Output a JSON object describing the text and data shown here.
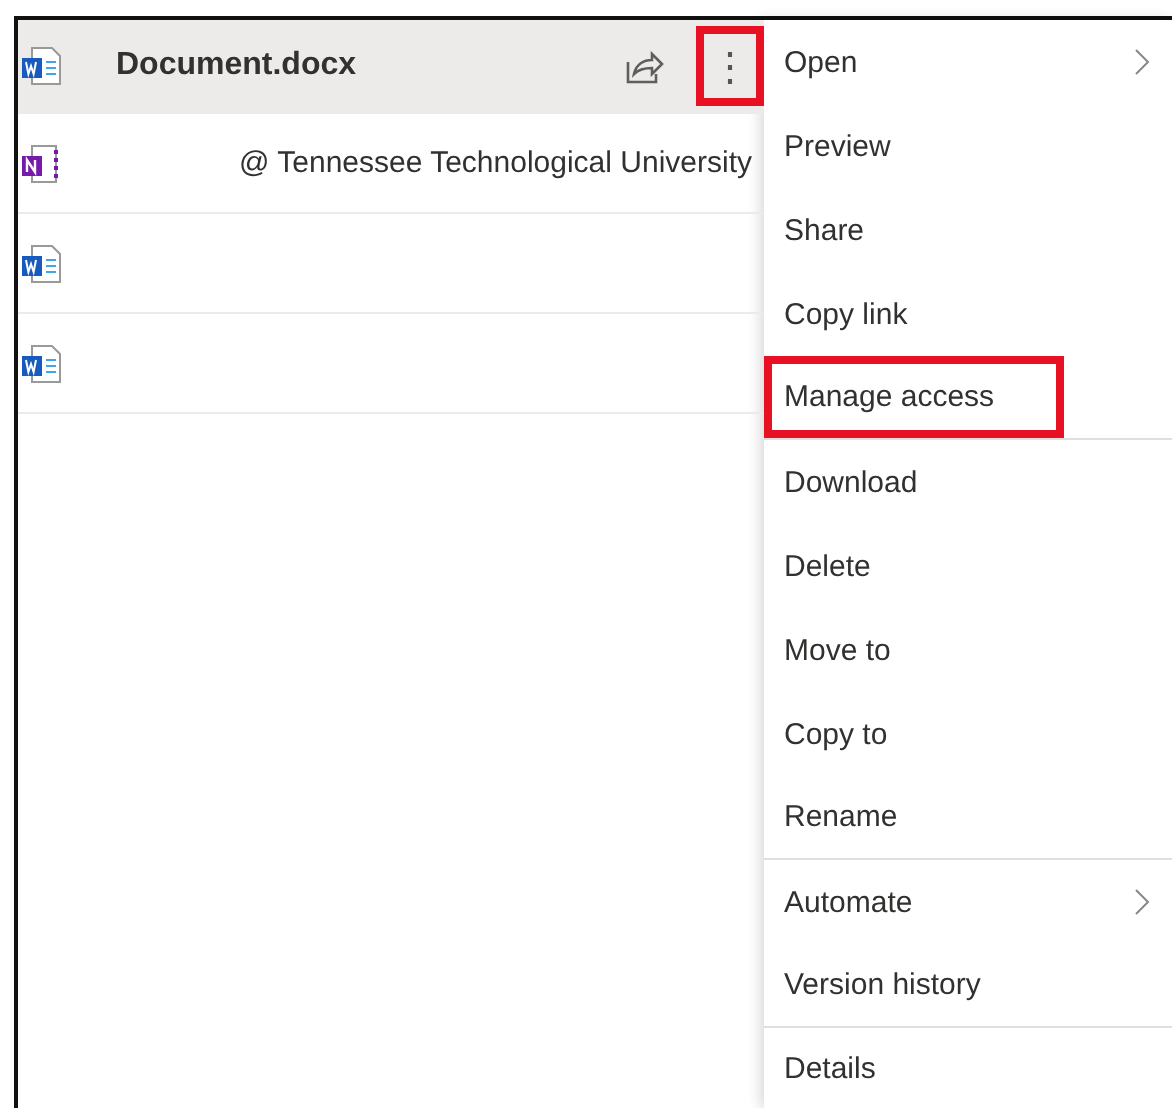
{
  "files": [
    {
      "kind": "word",
      "name": "Document.docx",
      "selected": true
    },
    {
      "kind": "onenote",
      "detail": "@ Tennessee Technological University",
      "selected": false
    },
    {
      "kind": "word",
      "selected": false
    },
    {
      "kind": "word",
      "selected": false
    }
  ],
  "more_button": {
    "label": "⋮",
    "highlighted": true
  },
  "context_menu": {
    "groups": [
      [
        {
          "label": "Open",
          "submenu": true,
          "highlighted": false
        },
        {
          "label": "Preview",
          "submenu": false,
          "highlighted": false
        },
        {
          "label": "Share",
          "submenu": false,
          "highlighted": false
        },
        {
          "label": "Copy link",
          "submenu": false,
          "highlighted": false
        },
        {
          "label": "Manage access",
          "submenu": false,
          "highlighted": true
        }
      ],
      [
        {
          "label": "Download",
          "submenu": false,
          "highlighted": false
        },
        {
          "label": "Delete",
          "submenu": false,
          "highlighted": false
        },
        {
          "label": "Move to",
          "submenu": false,
          "highlighted": false
        },
        {
          "label": "Copy to",
          "submenu": false,
          "highlighted": false
        },
        {
          "label": "Rename",
          "submenu": false,
          "highlighted": false
        }
      ],
      [
        {
          "label": "Automate",
          "submenu": true,
          "highlighted": false
        },
        {
          "label": "Version history",
          "submenu": false,
          "highlighted": false
        }
      ],
      [
        {
          "label": "Details",
          "submenu": false,
          "highlighted": false
        }
      ]
    ]
  }
}
